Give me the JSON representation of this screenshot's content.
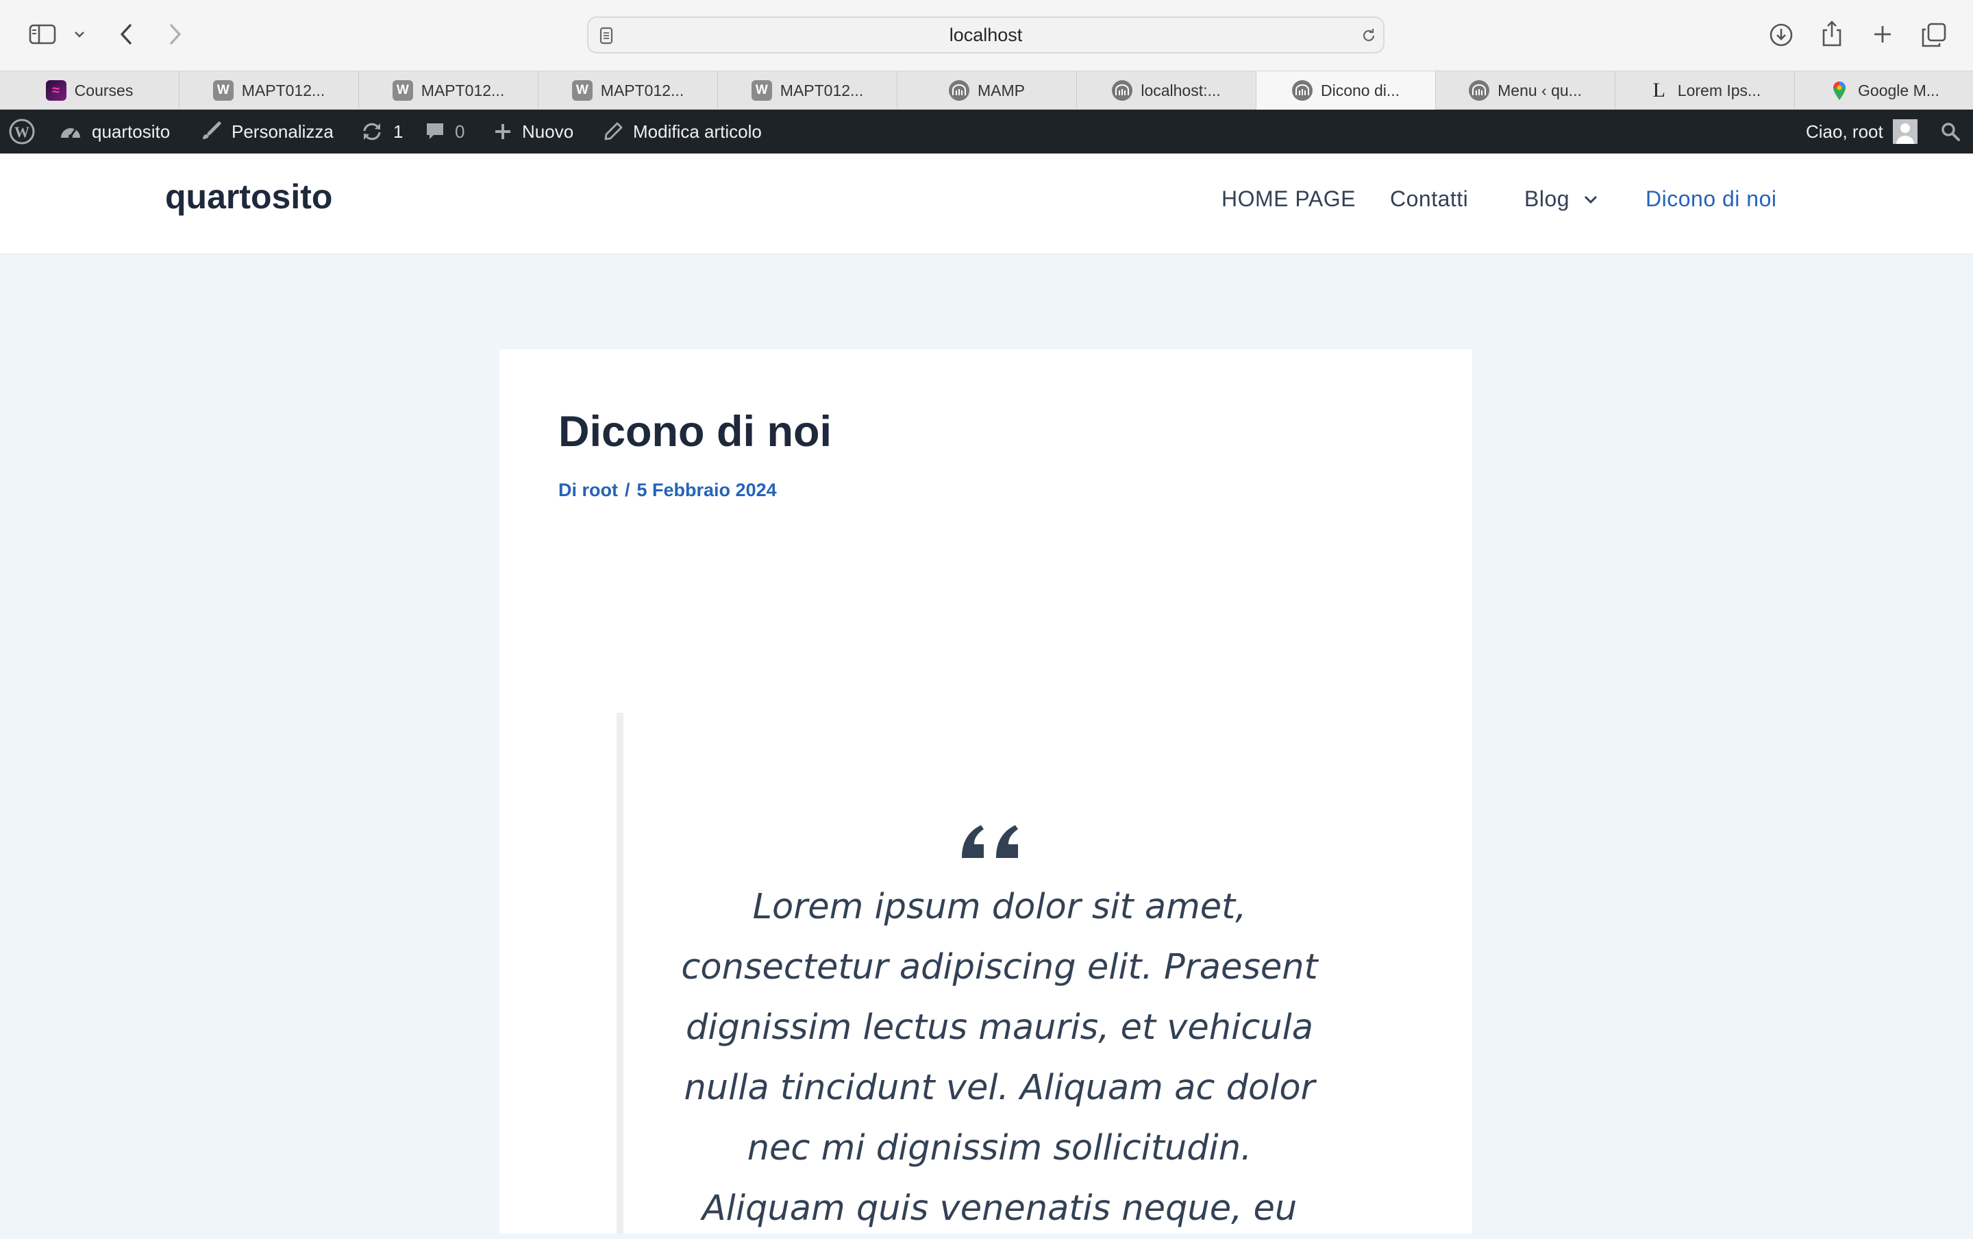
{
  "browser": {
    "url": "localhost",
    "tabs": [
      {
        "label": "Courses",
        "icon": "courses-favicon"
      },
      {
        "label": "MAPT012...",
        "icon": "w-favicon"
      },
      {
        "label": "MAPT012...",
        "icon": "w-favicon"
      },
      {
        "label": "MAPT012...",
        "icon": "w-favicon"
      },
      {
        "label": "MAPT012...",
        "icon": "w-favicon"
      },
      {
        "label": "MAMP",
        "icon": "mamp-favicon"
      },
      {
        "label": "localhost:...",
        "icon": "mamp-favicon"
      },
      {
        "label": "Dicono di...",
        "icon": "mamp-favicon",
        "active": true
      },
      {
        "label": "Menu ‹ qu...",
        "icon": "mamp-favicon"
      },
      {
        "label": "Lorem Ips...",
        "icon": "lorem-favicon"
      },
      {
        "label": "Google M...",
        "icon": "maps-favicon"
      }
    ]
  },
  "adminbar": {
    "site_name": "quartosito",
    "customize": "Personalizza",
    "updates_count": "1",
    "comments_count": "0",
    "new": "Nuovo",
    "edit_post": "Modifica articolo",
    "greeting": "Ciao, root"
  },
  "site": {
    "title": "quartosito",
    "nav": {
      "home": "HOME PAGE",
      "contacts": "Contatti",
      "blog": "Blog",
      "about": "Dicono di noi"
    }
  },
  "post": {
    "title": "Dicono di noi",
    "meta_author": "Di root",
    "meta_sep": "/",
    "meta_date": "5 Febbraio 2024",
    "quote_lines": [
      "Lorem ipsum dolor sit amet,",
      "consectetur adipiscing elit. Praesent",
      "dignissim lectus mauris, et vehicula",
      "nulla tincidunt vel. Aliquam ac dolor",
      "nec mi dignissim sollicitudin.",
      "Aliquam quis venenatis neque, eu"
    ]
  },
  "colors": {
    "accent": "#2563b8",
    "heading": "#1e293b",
    "adminbar": "#1d2327",
    "page_bg": "#f0f5fa"
  }
}
